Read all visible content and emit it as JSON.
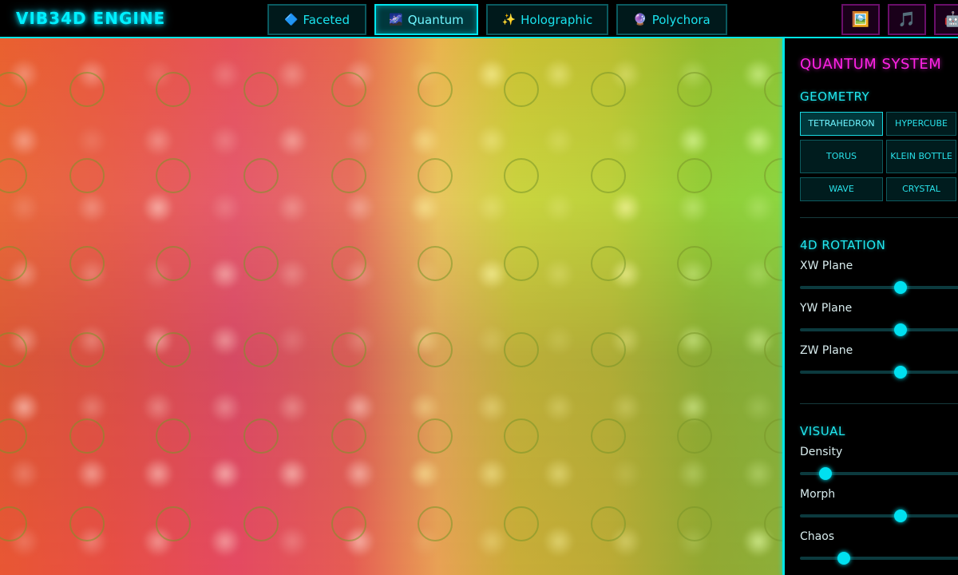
{
  "app": {
    "title": "VIB34D ENGINE"
  },
  "systems": [
    {
      "label": "Faceted",
      "icon": "🔷",
      "icon_name": "diamond-icon",
      "active": false
    },
    {
      "label": "Quantum",
      "icon": "🌌",
      "icon_name": "galaxy-icon",
      "active": true
    },
    {
      "label": "Holographic",
      "icon": "✨",
      "icon_name": "sparkles-icon",
      "active": false
    },
    {
      "label": "Polychora",
      "icon": "🔮",
      "icon_name": "crystal-ball-icon",
      "active": false
    }
  ],
  "tools": [
    {
      "icon": "🖼️",
      "icon_name": "gallery-icon"
    },
    {
      "icon": "🎵",
      "icon_name": "music-icon"
    },
    {
      "icon": "🤖",
      "icon_name": "robot-icon"
    }
  ],
  "panel": {
    "title": "QUANTUM SYSTEM",
    "geometry": {
      "title": "GEOMETRY",
      "options": [
        "TETRAHEDRON",
        "HYPERCUBE",
        "TORUS",
        "KLEIN BOTTLE",
        "WAVE",
        "CRYSTAL"
      ],
      "selected": "TETRAHEDRON"
    },
    "rotation": {
      "title": "4D ROTATION",
      "sliders": [
        {
          "label": "XW Plane",
          "value": 0.6
        },
        {
          "label": "YW Plane",
          "value": 0.6
        },
        {
          "label": "ZW Plane",
          "value": 0.6
        }
      ]
    },
    "visual": {
      "title": "VISUAL",
      "sliders": [
        {
          "label": "Density",
          "value": 0.15
        },
        {
          "label": "Morph",
          "value": 0.6
        },
        {
          "label": "Chaos",
          "value": 0.26
        }
      ]
    }
  },
  "colors": {
    "accent": "#00e5e5",
    "title_magenta": "#ff22e6",
    "tool_border": "#6a0f6a"
  }
}
